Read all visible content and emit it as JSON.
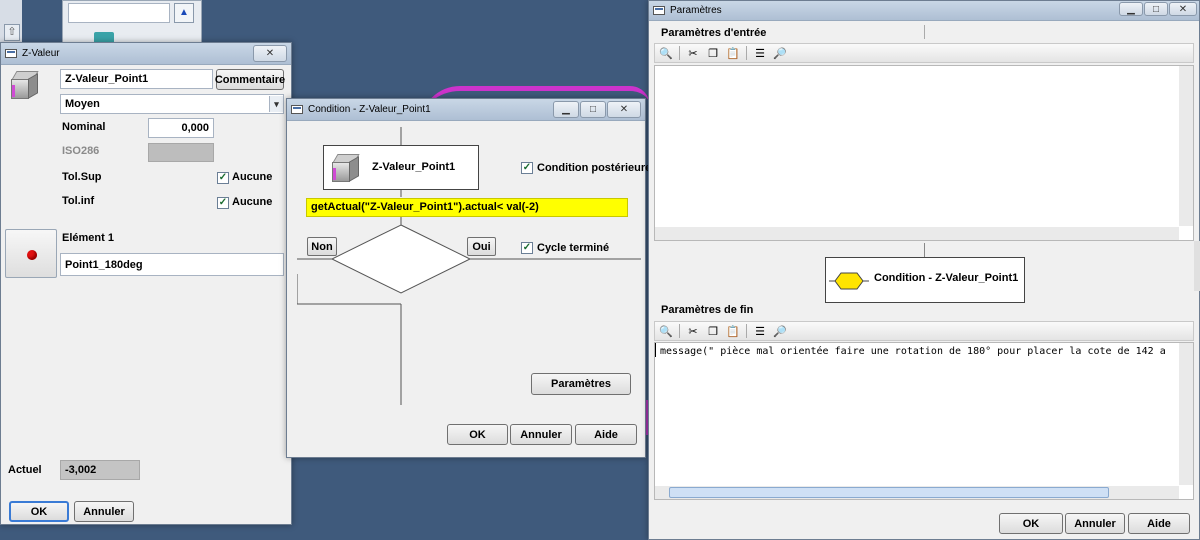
{
  "zvaleur": {
    "title": "Z-Valeur",
    "close": "✕",
    "name": "Z-Valeur_Point1",
    "comment_button": "Commentaire",
    "type": "Moyen",
    "nominal_label": "Nominal",
    "nominal_value": "0,000",
    "iso_label": "ISO286",
    "tolsup_label": "Tol.Sup",
    "tolinf_label": "Tol.inf",
    "none_label": "Aucune",
    "element_label": "Elément 1",
    "element_value": "Point1_180deg",
    "actual_label": "Actuel",
    "actual_value": "-3,002",
    "ok": "OK",
    "cancel": "Annuler"
  },
  "condition": {
    "title": "Condition - Z-Valeur_Point1",
    "node_name": "Z-Valeur_Point1",
    "post_condition": "Condition postérieure",
    "expression": "getActual(\"Z-Valeur_Point1\").actual< val(-2)",
    "no": "Non",
    "yes": "Oui",
    "cycle_done": "Cycle terminé",
    "params_button": "Paramètres",
    "ok": "OK",
    "cancel": "Annuler",
    "help": "Aide"
  },
  "parametres": {
    "title": "Paramètres",
    "input_section": "Paramètres d'entrée",
    "node_label": "Condition - Z-Valeur_Point1",
    "end_section": "Paramètres de fin",
    "end_code": "message(\" pièce mal orientée faire une rotation de 180° pour placer la cote de 142 a",
    "ok": "OK",
    "cancel": "Annuler",
    "help": "Aide"
  },
  "colors": {
    "expression_bg": "#ffff00",
    "accent_magenta": "#cc33cc"
  }
}
